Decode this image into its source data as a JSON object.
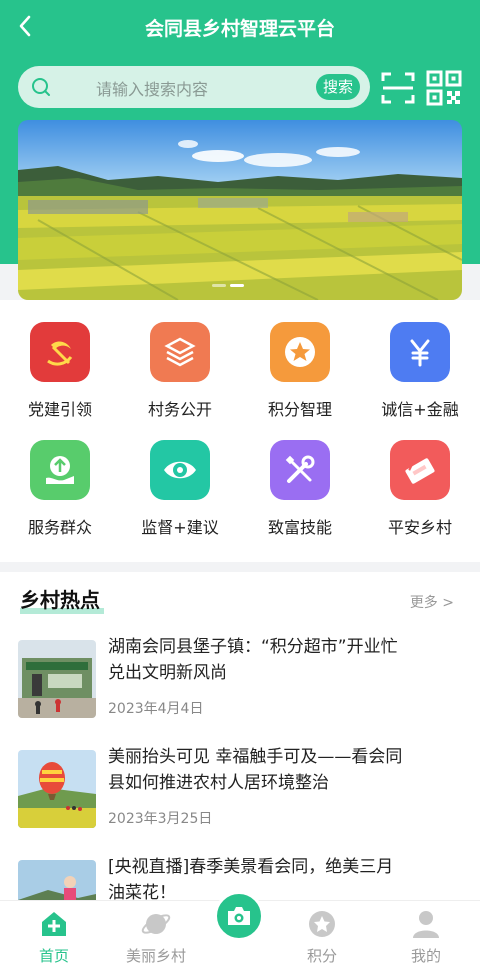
{
  "header": {
    "title": "会同县乡村智理云平台",
    "search_placeholder": "请输入搜索内容",
    "search_button": "搜索"
  },
  "banner": {
    "slides_total": 2,
    "active_slide": 2
  },
  "services": [
    {
      "label": "党建引领",
      "icon": "hammer-sickle-icon",
      "color": "#e23b3b"
    },
    {
      "label": "村务公开",
      "icon": "layers-icon",
      "color": "#f07a52"
    },
    {
      "label": "积分智理",
      "icon": "star-badge-icon",
      "color": "#f59a3c"
    },
    {
      "label": "诚信+金融",
      "icon": "yen-icon",
      "color": "#4e7cf2"
    },
    {
      "label": "服务群众",
      "icon": "upload-hand-icon",
      "color": "#58cc6c"
    },
    {
      "label": "监督+建议",
      "icon": "eye-icon",
      "color": "#23c7a4"
    },
    {
      "label": "致富技能",
      "icon": "tools-icon",
      "color": "#9a6ef2"
    },
    {
      "label": "平安乡村",
      "icon": "police-tag-icon",
      "color": "#f25b5b"
    }
  ],
  "news": {
    "title": "乡村热点",
    "more": "更多 >",
    "items": [
      {
        "headline": "湖南会同县堡子镇：“积分超市”开业忙 兑出文明新风尚",
        "date": "2023年4月4日"
      },
      {
        "headline": "美丽抬头可见 幸福触手可及——看会同县如何推进农村人居环境整治",
        "date": "2023年3月25日"
      },
      {
        "headline": "[央视直播]春季美景看会同，绝美三月油菜花！",
        "date": ""
      }
    ]
  },
  "tabbar": {
    "items": [
      {
        "label": "首页",
        "icon": "home-plus-icon",
        "active": true
      },
      {
        "label": "美丽乡村",
        "icon": "planet-icon",
        "active": false
      },
      {
        "label": "",
        "icon": "camera-icon",
        "active": false
      },
      {
        "label": "积分",
        "icon": "star-coin-icon",
        "active": false
      },
      {
        "label": "我的",
        "icon": "user-icon",
        "active": false
      }
    ]
  },
  "colors": {
    "brand": "#27c38c",
    "background": "#f2f3f5"
  }
}
